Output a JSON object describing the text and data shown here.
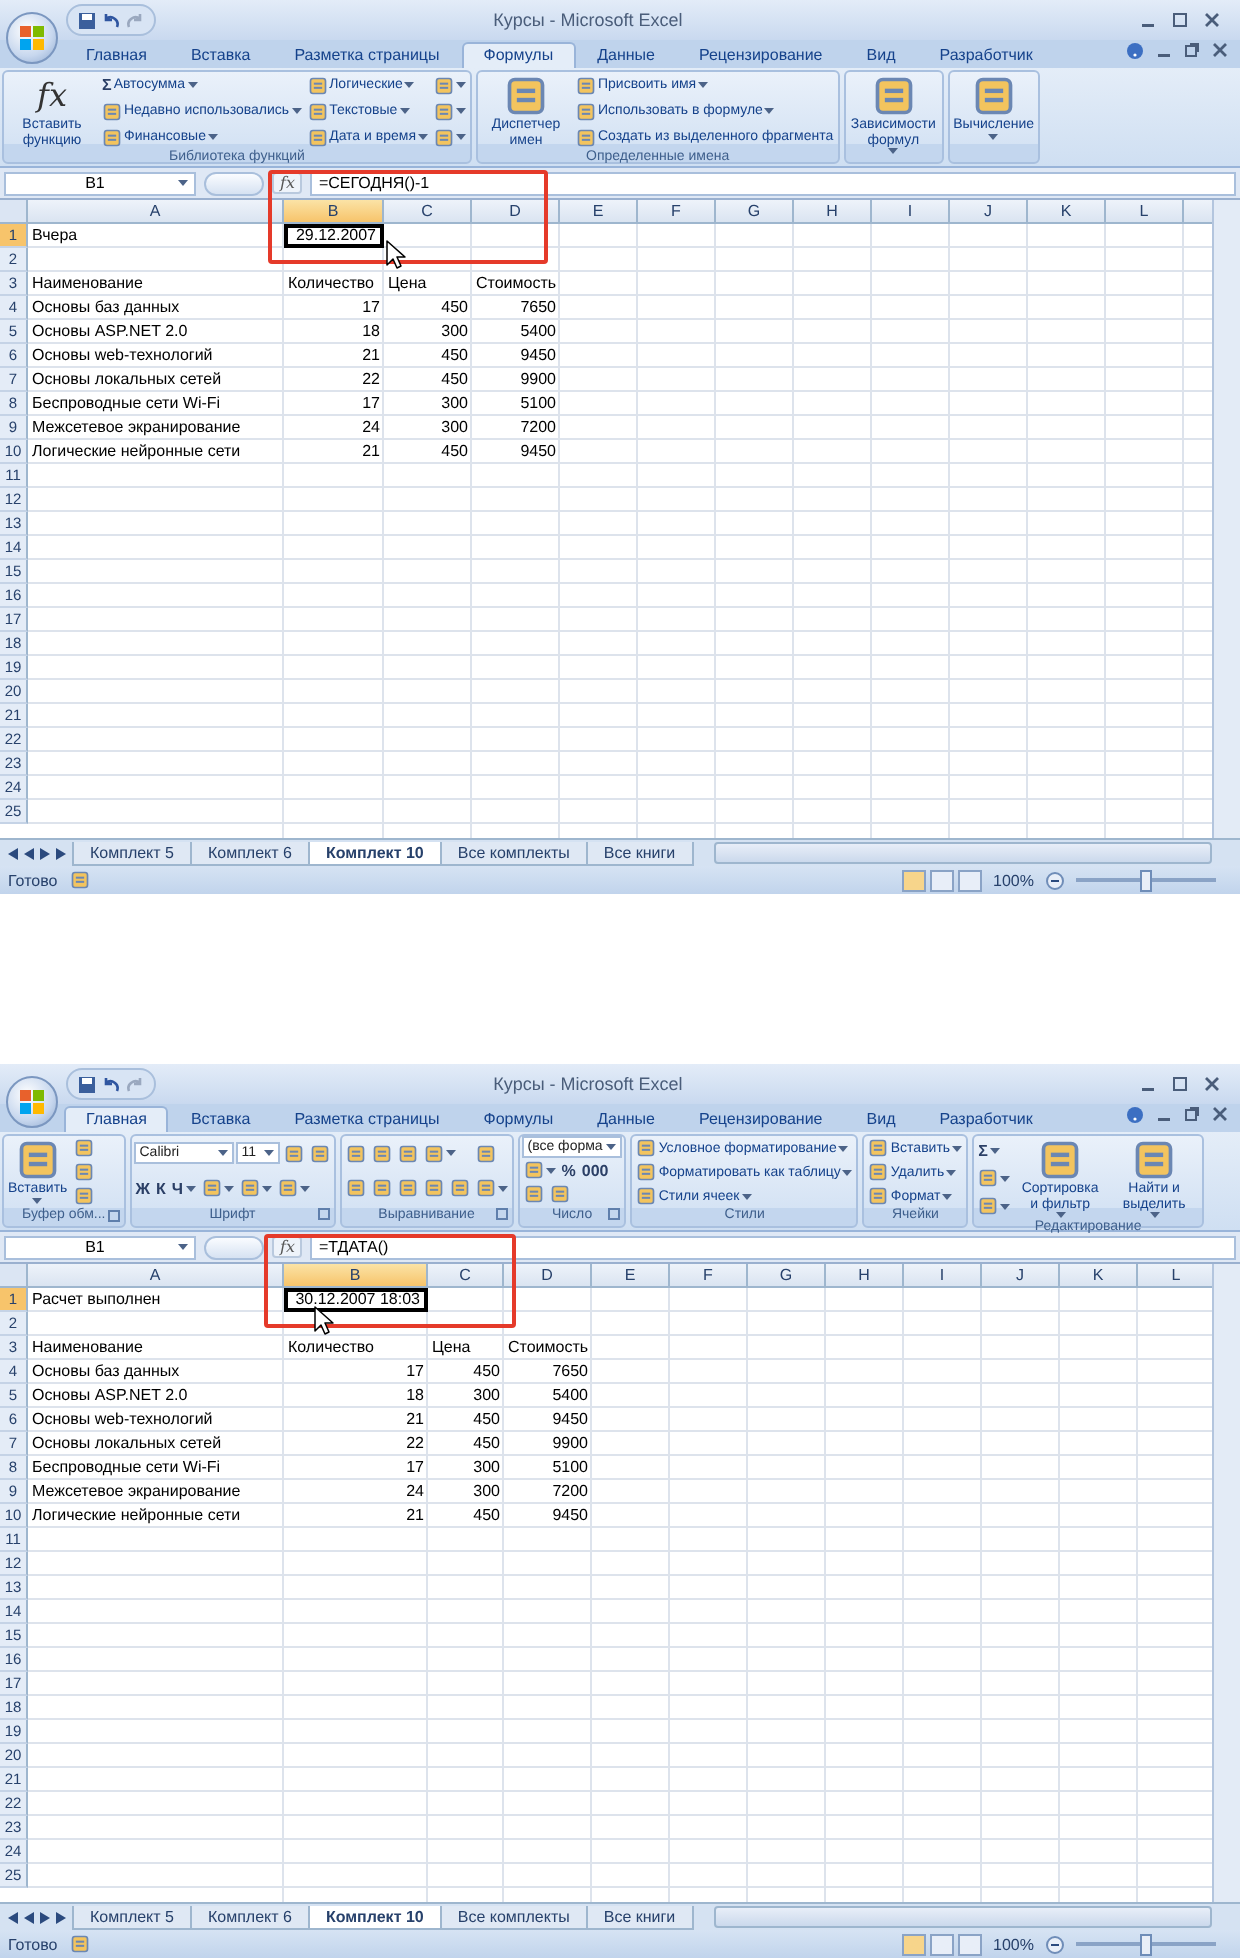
{
  "windows": [
    {
      "title": "Курсы - Microsoft Excel",
      "tabs": [
        {
          "label": "Главная",
          "selected": false
        },
        {
          "label": "Вставка",
          "selected": false
        },
        {
          "label": "Разметка страницы",
          "selected": false
        },
        {
          "label": "Формулы",
          "selected": true
        },
        {
          "label": "Данные",
          "selected": false
        },
        {
          "label": "Рецензирование",
          "selected": false
        },
        {
          "label": "Вид",
          "selected": false
        },
        {
          "label": "Разработчик",
          "selected": false
        }
      ],
      "ribbon_groups": [
        {
          "label": "Библиотека функций",
          "launcher": false,
          "items": [
            {
              "kind": "large",
              "glyph": "fx",
              "label": "Вставить функцию",
              "dropdown": false
            },
            {
              "kind": "stack",
              "lines": [
                [
                  {
                    "kind": "small",
                    "glyph": "Σ",
                    "label": "Автосумма",
                    "dropdown": true
                  }
                ],
                [
                  {
                    "kind": "small",
                    "label": "Недавно использовались",
                    "dropdown": true
                  }
                ],
                [
                  {
                    "kind": "small",
                    "label": "Финансовые",
                    "dropdown": true
                  }
                ]
              ]
            },
            {
              "kind": "stack",
              "lines": [
                [
                  {
                    "kind": "small",
                    "label": "Логические",
                    "dropdown": true
                  }
                ],
                [
                  {
                    "kind": "small",
                    "label": "Текстовые",
                    "dropdown": true
                  }
                ],
                [
                  {
                    "kind": "small",
                    "label": "Дата и время",
                    "dropdown": true
                  }
                ]
              ]
            },
            {
              "kind": "stack",
              "lines": [
                [
                  {
                    "kind": "icon",
                    "dropdown": true
                  }
                ],
                [
                  {
                    "kind": "icon",
                    "dropdown": true
                  }
                ],
                [
                  {
                    "kind": "icon",
                    "dropdown": true
                  }
                ]
              ]
            }
          ]
        },
        {
          "label": "Определенные имена",
          "launcher": false,
          "items": [
            {
              "kind": "large",
              "label": "Диспетчер имен",
              "dropdown": false
            },
            {
              "kind": "stack",
              "lines": [
                [
                  {
                    "kind": "small",
                    "label": "Присвоить имя",
                    "dropdown": true
                  }
                ],
                [
                  {
                    "kind": "small",
                    "label": "Использовать в формуле",
                    "dropdown": true
                  }
                ],
                [
                  {
                    "kind": "small",
                    "label": "Создать из выделенного фрагмента",
                    "dropdown": false
                  }
                ]
              ]
            }
          ]
        },
        {
          "launcher": false,
          "items": [
            {
              "kind": "large",
              "label": "Зависимости формул",
              "dropdown": true
            }
          ]
        },
        {
          "launcher": false,
          "items": [
            {
              "kind": "large",
              "label": "Вычисление",
              "dropdown": true
            }
          ]
        }
      ],
      "name_box": "B1",
      "function_glyph": "fx",
      "formula": "=СЕГОДНЯ()-1",
      "columns": [
        {
          "label": "A",
          "selected": false
        },
        {
          "label": "B",
          "selected": true
        },
        {
          "label": "C",
          "selected": false
        },
        {
          "label": "D",
          "selected": false
        },
        {
          "label": "E",
          "selected": false
        },
        {
          "label": "F",
          "selected": false
        },
        {
          "label": "G",
          "selected": false
        },
        {
          "label": "H",
          "selected": false
        },
        {
          "label": "I",
          "selected": false
        },
        {
          "label": "J",
          "selected": false
        },
        {
          "label": "K",
          "selected": false
        },
        {
          "label": "L",
          "selected": false
        }
      ],
      "rows": [
        {
          "number": "1",
          "selected": true,
          "cells": [
            "Вчера",
            "29.12.2007"
          ]
        },
        {
          "number": "2",
          "selected": false,
          "cells": []
        },
        {
          "number": "3",
          "selected": false,
          "cells": [
            "Наименование",
            "Количество",
            "Цена",
            "Стоимость"
          ]
        },
        {
          "number": "4",
          "selected": false,
          "cells": [
            "Основы баз данных",
            "17",
            "450",
            "7650"
          ]
        },
        {
          "number": "5",
          "selected": false,
          "cells": [
            "Основы ASP.NET 2.0",
            "18",
            "300",
            "5400"
          ]
        },
        {
          "number": "6",
          "selected": false,
          "cells": [
            "Основы web-технологий",
            "21",
            "450",
            "9450"
          ]
        },
        {
          "number": "7",
          "selected": false,
          "cells": [
            "Основы локальных сетей",
            "22",
            "450",
            "9900"
          ]
        },
        {
          "number": "8",
          "selected": false,
          "cells": [
            "Беспроводные сети Wi-Fi",
            "17",
            "300",
            "5100"
          ]
        },
        {
          "number": "9",
          "selected": false,
          "cells": [
            "Межсетевое экранирование",
            "24",
            "300",
            "7200"
          ]
        },
        {
          "number": "10",
          "selected": false,
          "cells": [
            "Логические нейронные сети",
            "21",
            "450",
            "9450"
          ]
        },
        {
          "number": "11",
          "selected": false,
          "cells": []
        },
        {
          "number": "12",
          "selected": false,
          "cells": []
        },
        {
          "number": "13",
          "selected": false,
          "cells": []
        },
        {
          "number": "14",
          "selected": false,
          "cells": []
        },
        {
          "number": "15",
          "selected": false,
          "cells": []
        },
        {
          "number": "16",
          "selected": false,
          "cells": []
        },
        {
          "number": "17",
          "selected": false,
          "cells": []
        },
        {
          "number": "18",
          "selected": false,
          "cells": []
        },
        {
          "number": "19",
          "selected": false,
          "cells": []
        },
        {
          "number": "20",
          "selected": false,
          "cells": []
        },
        {
          "number": "21",
          "selected": false,
          "cells": []
        },
        {
          "number": "22",
          "selected": false,
          "cells": []
        },
        {
          "number": "23",
          "selected": false,
          "cells": []
        },
        {
          "number": "24",
          "selected": false,
          "cells": []
        },
        {
          "number": "25",
          "selected": false,
          "cells": []
        }
      ],
      "sheet_tabs": [
        {
          "label": "Комплект 5",
          "selected": false
        },
        {
          "label": "Комплект 6",
          "selected": false
        },
        {
          "label": "Комплект 10",
          "selected": true
        },
        {
          "label": "Все комплекты",
          "selected": false
        },
        {
          "label": "Все книги",
          "selected": false
        }
      ],
      "status": "Готово",
      "zoom": "100%",
      "zoom_slider": {
        "level": 0.5
      }
    },
    {
      "title": "Курсы - Microsoft Excel",
      "tabs": [
        {
          "label": "Главная",
          "selected": true
        },
        {
          "label": "Вставка",
          "selected": false
        },
        {
          "label": "Разметка страницы",
          "selected": false
        },
        {
          "label": "Формулы",
          "selected": false
        },
        {
          "label": "Данные",
          "selected": false
        },
        {
          "label": "Рецензирование",
          "selected": false
        },
        {
          "label": "Вид",
          "selected": false
        },
        {
          "label": "Разработчик",
          "selected": false
        }
      ],
      "ribbon_groups": [
        {
          "label": "Буфер обм...",
          "launcher": true,
          "items": [
            {
              "kind": "large",
              "label": "Вставить",
              "dropdown": true
            },
            {
              "kind": "stack",
              "lines": [
                [
                  {
                    "kind": "icon",
                    "dropdown": false
                  }
                ],
                [
                  {
                    "kind": "icon",
                    "dropdown": false
                  }
                ],
                [
                  {
                    "kind": "icon",
                    "dropdown": false
                  }
                ]
              ]
            }
          ]
        },
        {
          "label": "Шрифт",
          "launcher": true,
          "items": [
            {
              "kind": "stack",
              "lines": [
                [
                  {
                    "kind": "combo",
                    "label": "Calibri",
                    "wide": true
                  },
                  {
                    "kind": "combo",
                    "label": "11",
                    "wide": false
                  },
                  {
                    "kind": "icon",
                    "dropdown": false
                  },
                  {
                    "kind": "icon",
                    "dropdown": false
                  }
                ],
                [
                  {
                    "kind": "small",
                    "glyph": "Ж",
                    "dropdown": false
                  },
                  {
                    "kind": "small",
                    "glyph": "К",
                    "dropdown": false
                  },
                  {
                    "kind": "small",
                    "glyph": "Ч",
                    "dropdown": true
                  },
                  {
                    "kind": "icon",
                    "dropdown": true
                  },
                  {
                    "kind": "icon",
                    "dropdown": true
                  },
                  {
                    "kind": "icon",
                    "dropdown": true
                  }
                ]
              ]
            }
          ]
        },
        {
          "label": "Выравнивание",
          "launcher": true,
          "items": [
            {
              "kind": "stack",
              "lines": [
                [
                  {
                    "kind": "icon",
                    "dropdown": false
                  },
                  {
                    "kind": "icon",
                    "dropdown": false
                  },
                  {
                    "kind": "icon",
                    "dropdown": false
                  },
                  {
                    "kind": "icon",
                    "dropdown": true
                  }
                ],
                [
                  {
                    "kind": "icon",
                    "dropdown": false
                  },
                  {
                    "kind": "icon",
                    "dropdown": false
                  },
                  {
                    "kind": "icon",
                    "dropdown": false
                  },
                  {
                    "kind": "icon",
                    "dropdown": false
                  },
                  {
                    "kind": "icon",
                    "dropdown": false
                  }
                ]
              ]
            },
            {
              "kind": "stack",
              "lines": [
                [
                  {
                    "kind": "icon",
                    "dropdown": false
                  }
                ],
                [
                  {
                    "kind": "icon",
                    "dropdown": true
                  }
                ]
              ]
            }
          ]
        },
        {
          "label": "Число",
          "launcher": true,
          "items": [
            {
              "kind": "stack",
              "lines": [
                [
                  {
                    "kind": "combo",
                    "label": "(все форма",
                    "wide": false
                  }
                ],
                [
                  {
                    "kind": "icon",
                    "dropdown": true
                  },
                  {
                    "kind": "small",
                    "glyph": "%",
                    "dropdown": false
                  },
                  {
                    "kind": "small",
                    "glyph": "000",
                    "dropdown": false
                  }
                ],
                [
                  {
                    "kind": "icon",
                    "dropdown": false
                  },
                  {
                    "kind": "icon",
                    "dropdown": false
                  }
                ]
              ]
            }
          ]
        },
        {
          "label": "Стили",
          "launcher": false,
          "items": [
            {
              "kind": "stack",
              "lines": [
                [
                  {
                    "kind": "small",
                    "label": "Условное форматирование",
                    "dropdown": true
                  }
                ],
                [
                  {
                    "kind": "small",
                    "label": "Форматировать как таблицу",
                    "dropdown": true
                  }
                ],
                [
                  {
                    "kind": "small",
                    "label": "Стили ячеек",
                    "dropdown": true
                  }
                ]
              ]
            }
          ]
        },
        {
          "label": "Ячейки",
          "launcher": false,
          "items": [
            {
              "kind": "stack",
              "lines": [
                [
                  {
                    "kind": "small",
                    "label": "Вставить",
                    "dropdown": true
                  }
                ],
                [
                  {
                    "kind": "small",
                    "label": "Удалить",
                    "dropdown": true
                  }
                ],
                [
                  {
                    "kind": "small",
                    "label": "Формат",
                    "dropdown": true
                  }
                ]
              ]
            }
          ]
        },
        {
          "label": "Редактирование",
          "launcher": false,
          "items": [
            {
              "kind": "stack",
              "lines": [
                [
                  {
                    "kind": "small",
                    "glyph": "Σ",
                    "dropdown": true
                  }
                ],
                [
                  {
                    "kind": "icon",
                    "dropdown": true
                  }
                ],
                [
                  {
                    "kind": "icon",
                    "dropdown": true
                  }
                ]
              ]
            },
            {
              "kind": "large",
              "label": "Сортировка и фильтр",
              "dropdown": true
            },
            {
              "kind": "large",
              "label": "Найти и выделить",
              "dropdown": true
            }
          ]
        }
      ],
      "name_box": "B1",
      "function_glyph": "fx",
      "formula": "=ТДАТА()",
      "columns": [
        {
          "label": "A",
          "selected": false
        },
        {
          "label": "B",
          "selected": true
        },
        {
          "label": "C",
          "selected": false
        },
        {
          "label": "D",
          "selected": false
        },
        {
          "label": "E",
          "selected": false
        },
        {
          "label": "F",
          "selected": false
        },
        {
          "label": "G",
          "selected": false
        },
        {
          "label": "H",
          "selected": false
        },
        {
          "label": "I",
          "selected": false
        },
        {
          "label": "J",
          "selected": false
        },
        {
          "label": "K",
          "selected": false
        },
        {
          "label": "L",
          "selected": false
        }
      ],
      "rows": [
        {
          "number": "1",
          "selected": true,
          "cells": [
            "Расчет выполнен",
            "30.12.2007 18:03"
          ]
        },
        {
          "number": "2",
          "selected": false,
          "cells": []
        },
        {
          "number": "3",
          "selected": false,
          "cells": [
            "Наименование",
            "Количество",
            "Цена",
            "Стоимость"
          ]
        },
        {
          "number": "4",
          "selected": false,
          "cells": [
            "Основы баз данных",
            "17",
            "450",
            "7650"
          ]
        },
        {
          "number": "5",
          "selected": false,
          "cells": [
            "Основы ASP.NET 2.0",
            "18",
            "300",
            "5400"
          ]
        },
        {
          "number": "6",
          "selected": false,
          "cells": [
            "Основы web-технологий",
            "21",
            "450",
            "9450"
          ]
        },
        {
          "number": "7",
          "selected": false,
          "cells": [
            "Основы локальных сетей",
            "22",
            "450",
            "9900"
          ]
        },
        {
          "number": "8",
          "selected": false,
          "cells": [
            "Беспроводные сети Wi-Fi",
            "17",
            "300",
            "5100"
          ]
        },
        {
          "number": "9",
          "selected": false,
          "cells": [
            "Межсетевое экранирование",
            "24",
            "300",
            "7200"
          ]
        },
        {
          "number": "10",
          "selected": false,
          "cells": [
            "Логические нейронные сети",
            "21",
            "450",
            "9450"
          ]
        },
        {
          "number": "11",
          "selected": false,
          "cells": []
        },
        {
          "number": "12",
          "selected": false,
          "cells": []
        },
        {
          "number": "13",
          "selected": false,
          "cells": []
        },
        {
          "number": "14",
          "selected": false,
          "cells": []
        },
        {
          "number": "15",
          "selected": false,
          "cells": []
        },
        {
          "number": "16",
          "selected": false,
          "cells": []
        },
        {
          "number": "17",
          "selected": false,
          "cells": []
        },
        {
          "number": "18",
          "selected": false,
          "cells": []
        },
        {
          "number": "19",
          "selected": false,
          "cells": []
        },
        {
          "number": "20",
          "selected": false,
          "cells": []
        },
        {
          "number": "21",
          "selected": false,
          "cells": []
        },
        {
          "number": "22",
          "selected": false,
          "cells": []
        },
        {
          "number": "23",
          "selected": false,
          "cells": []
        },
        {
          "number": "24",
          "selected": false,
          "cells": []
        },
        {
          "number": "25",
          "selected": false,
          "cells": []
        }
      ],
      "sheet_tabs": [
        {
          "label": "Комплект 5",
          "selected": false
        },
        {
          "label": "Комплект 6",
          "selected": false
        },
        {
          "label": "Комплект 10",
          "selected": true
        },
        {
          "label": "Все комплекты",
          "selected": false
        },
        {
          "label": "Все книги",
          "selected": false
        }
      ],
      "status": "Готово",
      "zoom": "100%",
      "zoom_slider": {
        "level": 0.5
      }
    }
  ]
}
